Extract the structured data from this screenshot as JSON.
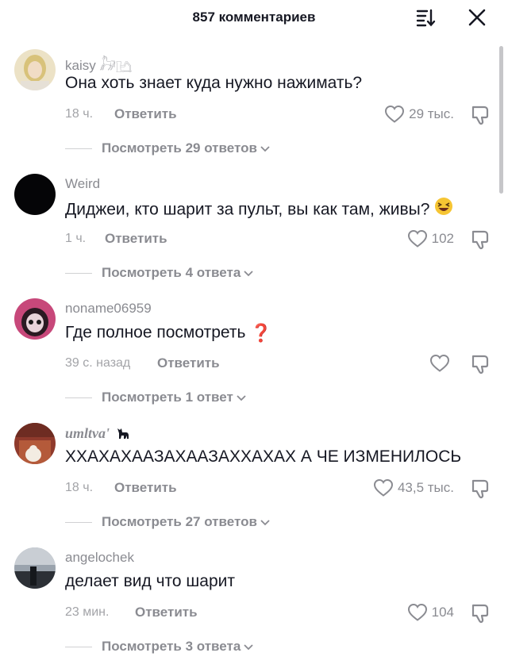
{
  "header": {
    "title": "857 комментариев"
  },
  "comments": [
    {
      "username": "kaisy 𓃗𓂛",
      "text": "Она хоть знает куда нужно нажимать?",
      "time": "18 ч.",
      "reply_label": "Ответить",
      "likes": "29 тыс.",
      "replies": "Посмотреть 29 ответов"
    },
    {
      "username": "Weird",
      "text": "Диджеи, кто шарит за пульт, вы как там, живы?",
      "time": "1 ч.",
      "reply_label": "Ответить",
      "likes": "102",
      "replies": "Посмотреть 4 ответа"
    },
    {
      "username": "noname06959",
      "text": "Где полное посмотреть",
      "text_emoji": "❓",
      "time": "39 с. назад",
      "reply_label": "Ответить",
      "likes": "",
      "replies": "Посмотреть 1 ответ"
    },
    {
      "username": "umltva'",
      "text": "ХХАХАХААЗАХААЗАХХАХАХ А ЧЕ ИЗМЕНИЛОСЬ",
      "time": "18 ч.",
      "reply_label": "Ответить",
      "likes": "43,5 тыс.",
      "replies": "Посмотреть 27 ответов"
    },
    {
      "username": "angelochek",
      "text": "делает вид что шарит",
      "time": "23 мин.",
      "reply_label": "Ответить",
      "likes": "104",
      "replies": "Посмотреть 3 ответа"
    }
  ],
  "icons": {
    "sort": "sort-icon",
    "close": "close-icon",
    "like": "heart-icon",
    "dislike": "thumbs-down-icon",
    "chevron": "chevron-down-icon"
  },
  "colors": {
    "primary_text": "#161823",
    "secondary_text": "#8a8b91",
    "red_question": "#e0282e"
  }
}
